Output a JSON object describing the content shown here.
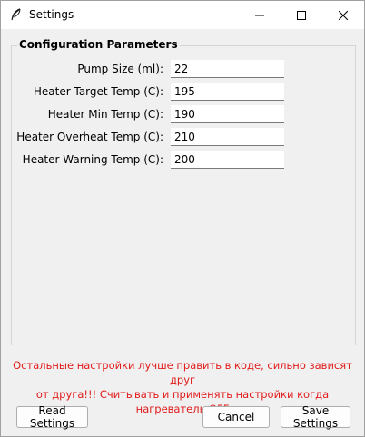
{
  "window": {
    "title": "Settings",
    "controls": {
      "minimize_icon": "minimize-icon",
      "maximize_icon": "maximize-icon",
      "close_icon": "close-icon"
    }
  },
  "group": {
    "label": "Configuration Parameters",
    "fields": [
      {
        "label": "Pump Size (ml):",
        "value": "22"
      },
      {
        "label": "Heater Target Temp (C):",
        "value": "195"
      },
      {
        "label": "Heater Min Temp (C):",
        "value": "190"
      },
      {
        "label": "Heater Overheat Temp (C):",
        "value": "210"
      },
      {
        "label": "Heater Warning Temp (C):",
        "value": "200"
      }
    ]
  },
  "warning": {
    "line1": "Остальные настройки лучше править в коде, сильно зависят друг",
    "line2": "от друга!!! Считывать и применять настройки когда нагреватель OFF",
    "color": "#e11c1c"
  },
  "buttons": {
    "read_label": "Read Settings",
    "cancel_label": "Cancel",
    "save_label": "Save Settings"
  }
}
